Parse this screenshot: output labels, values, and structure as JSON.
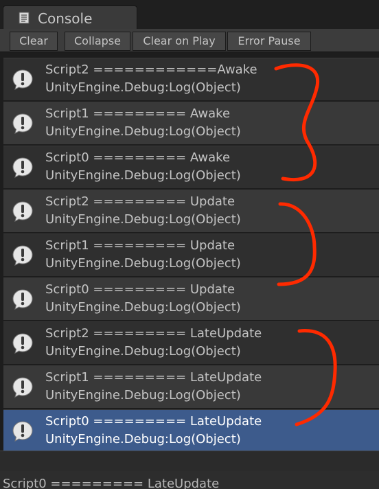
{
  "window": {
    "tab_title": "Console"
  },
  "toolbar": {
    "buttons": [
      "Clear",
      "Collapse",
      "Clear on Play",
      "Error Pause"
    ]
  },
  "log_entries": [
    {
      "message": "Script2 ============Awake",
      "trace": "UnityEngine.Debug:Log(Object)"
    },
    {
      "message": "Script1 ========= Awake",
      "trace": "UnityEngine.Debug:Log(Object)"
    },
    {
      "message": "Script0 ========= Awake",
      "trace": "UnityEngine.Debug:Log(Object)"
    },
    {
      "message": "Script2 ========= Update",
      "trace": "UnityEngine.Debug:Log(Object)"
    },
    {
      "message": "Script1 ========= Update",
      "trace": "UnityEngine.Debug:Log(Object)"
    },
    {
      "message": "Script0 ========= Update",
      "trace": "UnityEngine.Debug:Log(Object)"
    },
    {
      "message": "Script2 ========= LateUpdate",
      "trace": "UnityEngine.Debug:Log(Object)"
    },
    {
      "message": "Script1 ========= LateUpdate",
      "trace": "UnityEngine.Debug:Log(Object)"
    },
    {
      "message": "Script0 ========= LateUpdate",
      "trace": "UnityEngine.Debug:Log(Object)"
    }
  ],
  "selected_index": 8,
  "status_bar": {
    "text": "Script0 ========= LateUpdate"
  },
  "icons": {
    "tab": "console-icon",
    "entry": "info-exclamation-icon"
  },
  "colors": {
    "selection": "#3d5b8c",
    "annotation": "#ff2a00"
  }
}
